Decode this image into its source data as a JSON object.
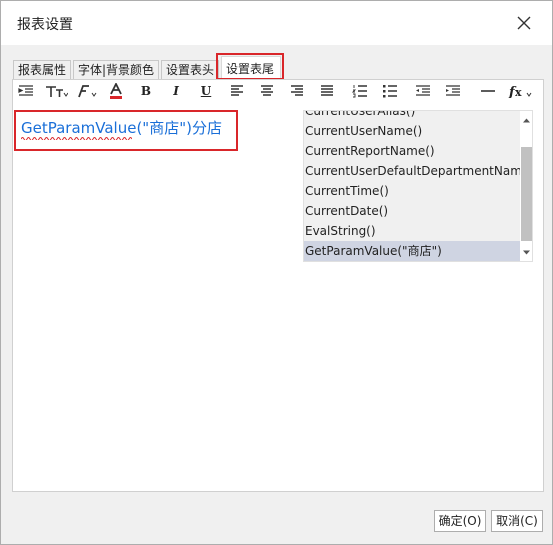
{
  "window": {
    "title": "报表设置"
  },
  "tabs": [
    {
      "label": "报表属性"
    },
    {
      "label": "字体|背景颜色"
    },
    {
      "label": "设置表头"
    },
    {
      "label": "设置表尾",
      "active": true
    }
  ],
  "toolbar": {
    "icons": [
      "indent-icon",
      "font-size-icon",
      "font-family-icon",
      "font-color-icon",
      "bold-icon",
      "italic-icon",
      "underline-icon",
      "align-left-icon",
      "align-center-icon",
      "align-right-icon",
      "justify-icon",
      "ordered-list-icon",
      "unordered-list-icon",
      "outdent-icon",
      "indent-more-icon",
      "horizontal-rule-icon",
      "function-icon"
    ],
    "bold_label": "B",
    "italic_label": "I",
    "underline_label": "U",
    "font_color": "#d9262a"
  },
  "editor": {
    "content": "GetParamValue(\"商店\")分店"
  },
  "autocomplete": {
    "items": [
      "CurrentUserAlias()",
      "CurrentUserName()",
      "CurrentReportName()",
      "CurrentUserDefaultDepartmentName()",
      "CurrentTime()",
      "CurrentDate()",
      "EvalString()",
      "GetParamValue(\"商店\")"
    ],
    "selected_index": 7
  },
  "buttons": {
    "ok": "确定(O)",
    "cancel": "取消(C)"
  },
  "colors": {
    "highlight": "#d9262a",
    "link_text": "#1a6fd8",
    "selection": "#cfd4e2"
  }
}
